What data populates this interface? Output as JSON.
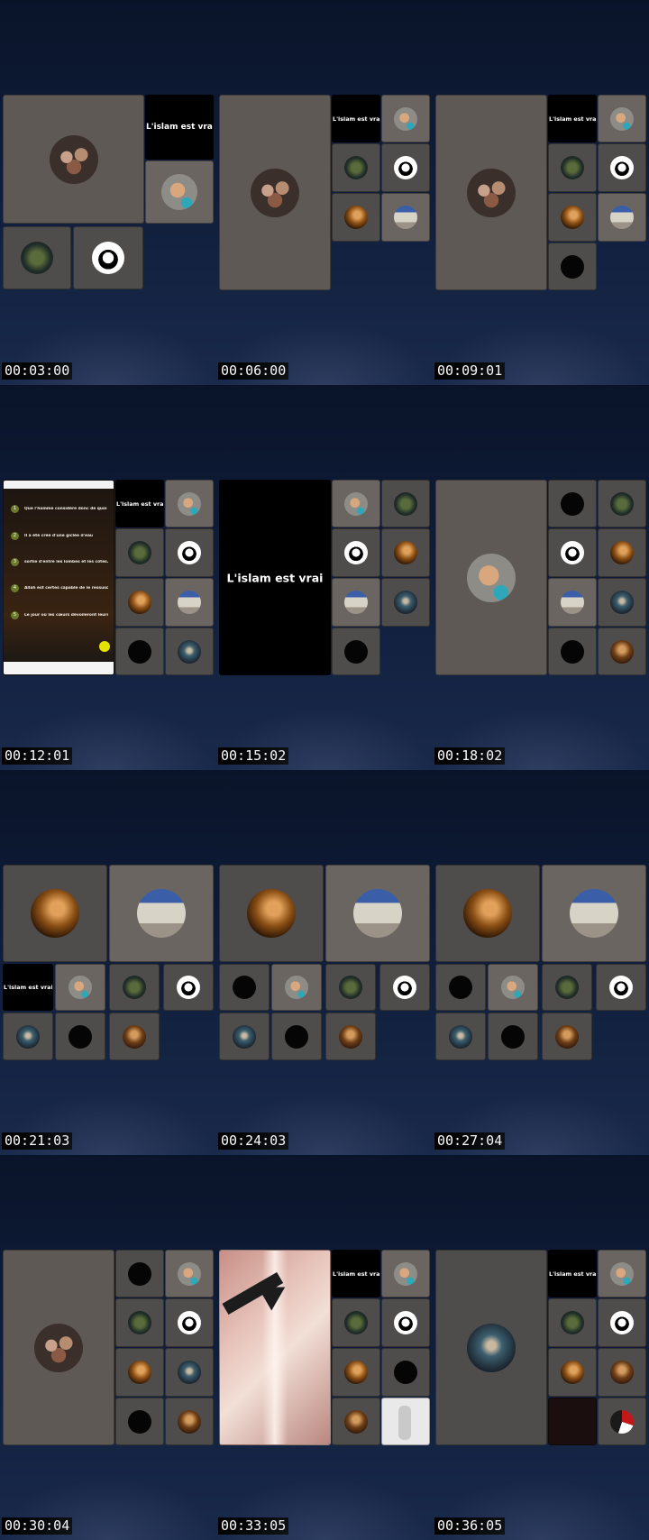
{
  "frames": [
    {
      "timestamp": "00:03:00",
      "label": "L'islam est vrai"
    },
    {
      "timestamp": "00:06:00",
      "label": "L'islam est vrai"
    },
    {
      "timestamp": "00:09:01",
      "label": "L'islam est vrai"
    },
    {
      "timestamp": "00:12:01",
      "label": "L'islam est vrai"
    },
    {
      "timestamp": "00:15:02",
      "label": "L'islam est vrai"
    },
    {
      "timestamp": "00:18:02",
      "label": ""
    },
    {
      "timestamp": "00:21:03",
      "label": "L'islam est vrai"
    },
    {
      "timestamp": "00:24:03",
      "label": ""
    },
    {
      "timestamp": "00:27:04",
      "label": ""
    },
    {
      "timestamp": "00:30:04",
      "label": ""
    },
    {
      "timestamp": "00:33:05",
      "label": "L'islam est vrai"
    },
    {
      "timestamp": "00:36:05",
      "label": "L'islam est vrai"
    }
  ],
  "shared_screen": {
    "questions": [
      {
        "num": "1",
        "text": "Que l'homme considère donc de quoi il a été créé."
      },
      {
        "num": "2",
        "text": "Il a été créé d'une giclée d'eau"
      },
      {
        "num": "3",
        "text": "sortie d'entre les lombes et les côtes."
      },
      {
        "num": "4",
        "text": "Allah est certes capable de le ressusciter."
      },
      {
        "num": "5",
        "text": "Le jour où les cœurs dévoileront leurs secrets,"
      }
    ]
  }
}
